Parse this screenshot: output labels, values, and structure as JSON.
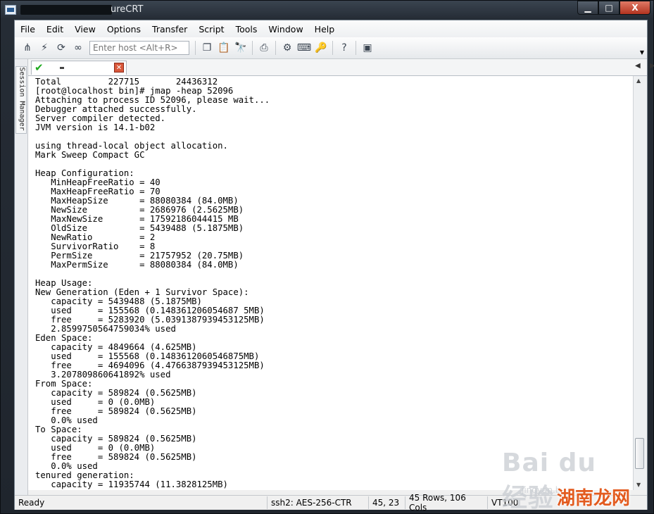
{
  "window": {
    "title_suffix": "ureCRT",
    "min_label": "▁",
    "max_label": "□",
    "close_label": "X"
  },
  "menu": [
    "File",
    "Edit",
    "View",
    "Options",
    "Transfer",
    "Script",
    "Tools",
    "Window",
    "Help"
  ],
  "toolbar": {
    "host_placeholder": "Enter host <Alt+R>"
  },
  "sidebar": {
    "label": "Session Manager"
  },
  "terminal": {
    "lines": [
      "Total         227715       24436312",
      "[root@localhost bin]# jmap -heap 52096",
      "Attaching to process ID 52096, please wait...",
      "Debugger attached successfully.",
      "Server compiler detected.",
      "JVM version is 14.1-b02",
      "",
      "using thread-local object allocation.",
      "Mark Sweep Compact GC",
      "",
      "Heap Configuration:",
      "   MinHeapFreeRatio = 40",
      "   MaxHeapFreeRatio = 70",
      "   MaxHeapSize      = 88080384 (84.0MB)",
      "   NewSize          = 2686976 (2.5625MB)",
      "   MaxNewSize       = 17592186044415 MB",
      "   OldSize          = 5439488 (5.1875MB)",
      "   NewRatio         = 2",
      "   SurvivorRatio    = 8",
      "   PermSize         = 21757952 (20.75MB)",
      "   MaxPermSize      = 88080384 (84.0MB)",
      "",
      "Heap Usage:",
      "New Generation (Eden + 1 Survivor Space):",
      "   capacity = 5439488 (5.1875MB)",
      "   used     = 155568 (0.148361206054687 5MB)",
      "   free     = 5283920 (5.0391387939453125MB)",
      "   2.8599750564759034% used",
      "Eden Space:",
      "   capacity = 4849664 (4.625MB)",
      "   used     = 155568 (0.1483612060546875MB)",
      "   free     = 4694096 (4.4766387939453125MB)",
      "   3.207809860641892% used",
      "From Space:",
      "   capacity = 589824 (0.5625MB)",
      "   used     = 0 (0.0MB)",
      "   free     = 589824 (0.5625MB)",
      "   0.0% used",
      "To Space:",
      "   capacity = 589824 (0.5625MB)",
      "   used     = 0 (0.0MB)",
      "   free     = 589824 (0.5625MB)",
      "   0.0% used",
      "tenured generation:",
      "   capacity = 11935744 (11.3828125MB)"
    ]
  },
  "status": {
    "ready": "Ready",
    "protocol": "ssh2: AES-256-CTR",
    "cursor": "45,  23",
    "size": "45 Rows, 106 Cols",
    "emulation": "VT100"
  },
  "watermark": {
    "brand": "Bai du 经验",
    "sub": "jingyan.b",
    "stamp": "湖南龙网"
  },
  "icons": {
    "tab_ok": "check-icon",
    "tab_close": "close-icon"
  },
  "colors": {
    "accent_green": "#1faa1f",
    "close_red": "#d9573a",
    "stamp_orange": "#e35b1f"
  }
}
